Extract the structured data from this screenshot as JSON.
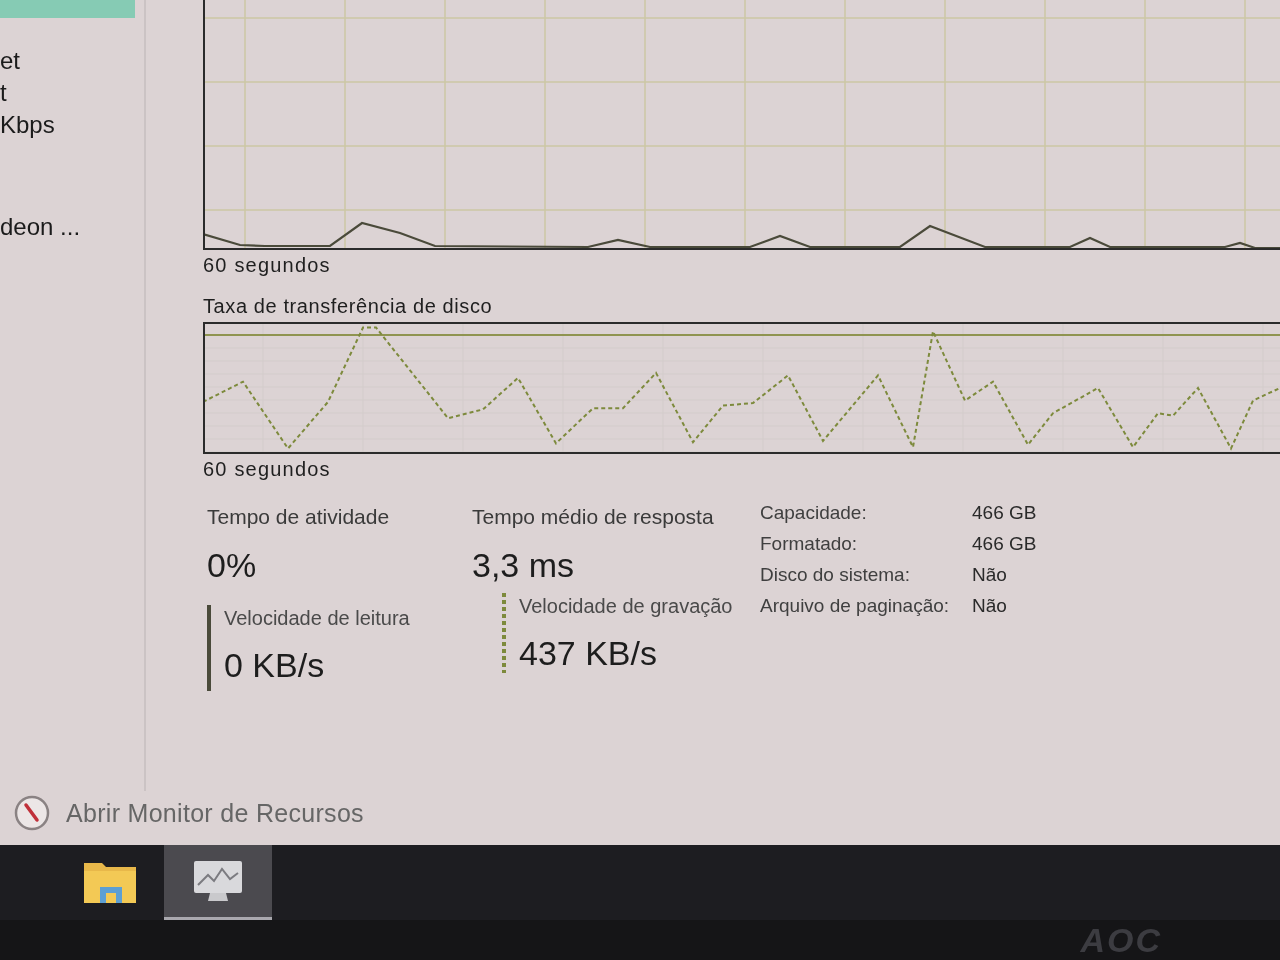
{
  "sidebar": {
    "items": [
      {
        "selected": true
      },
      {
        "lines": [
          "et",
          "t",
          "Kbps"
        ],
        "selected": false
      },
      {
        "lines": [
          "deon ..."
        ],
        "selected": false
      }
    ]
  },
  "charts": [
    {
      "kind": "activity",
      "time_label": "60 segundos"
    },
    {
      "kind": "transfer",
      "title": "Taxa de transferência de disco",
      "time_label": "60 segundos"
    }
  ],
  "stats": [
    {
      "label": "Tempo de atividade",
      "value": "0%"
    },
    {
      "label": "Tempo médio de resposta",
      "value": "3,3 ms"
    }
  ],
  "speeds": [
    {
      "kind": "solid",
      "label": "Velocidade de leitura",
      "value": "0 KB/s"
    },
    {
      "kind": "dashed",
      "label": "Velocidade de gravação",
      "value": "437 KB/s"
    }
  ],
  "details": [
    {
      "label": "Capacidade:",
      "value": "466 GB"
    },
    {
      "label": "Formatado:",
      "value": "466 GB"
    },
    {
      "label": "Disco do sistema:",
      "value": "Não"
    },
    {
      "label": "Arquivo de paginação:",
      "value": "Não"
    }
  ],
  "resource_monitor_link": {
    "label": "Abrir Monitor de Recursos"
  },
  "taskbar": {
    "items": [
      {
        "kind": "folder",
        "selected": false
      },
      {
        "kind": "task-manager",
        "selected": true
      }
    ]
  },
  "monitor": {
    "logo": "AOC"
  }
}
